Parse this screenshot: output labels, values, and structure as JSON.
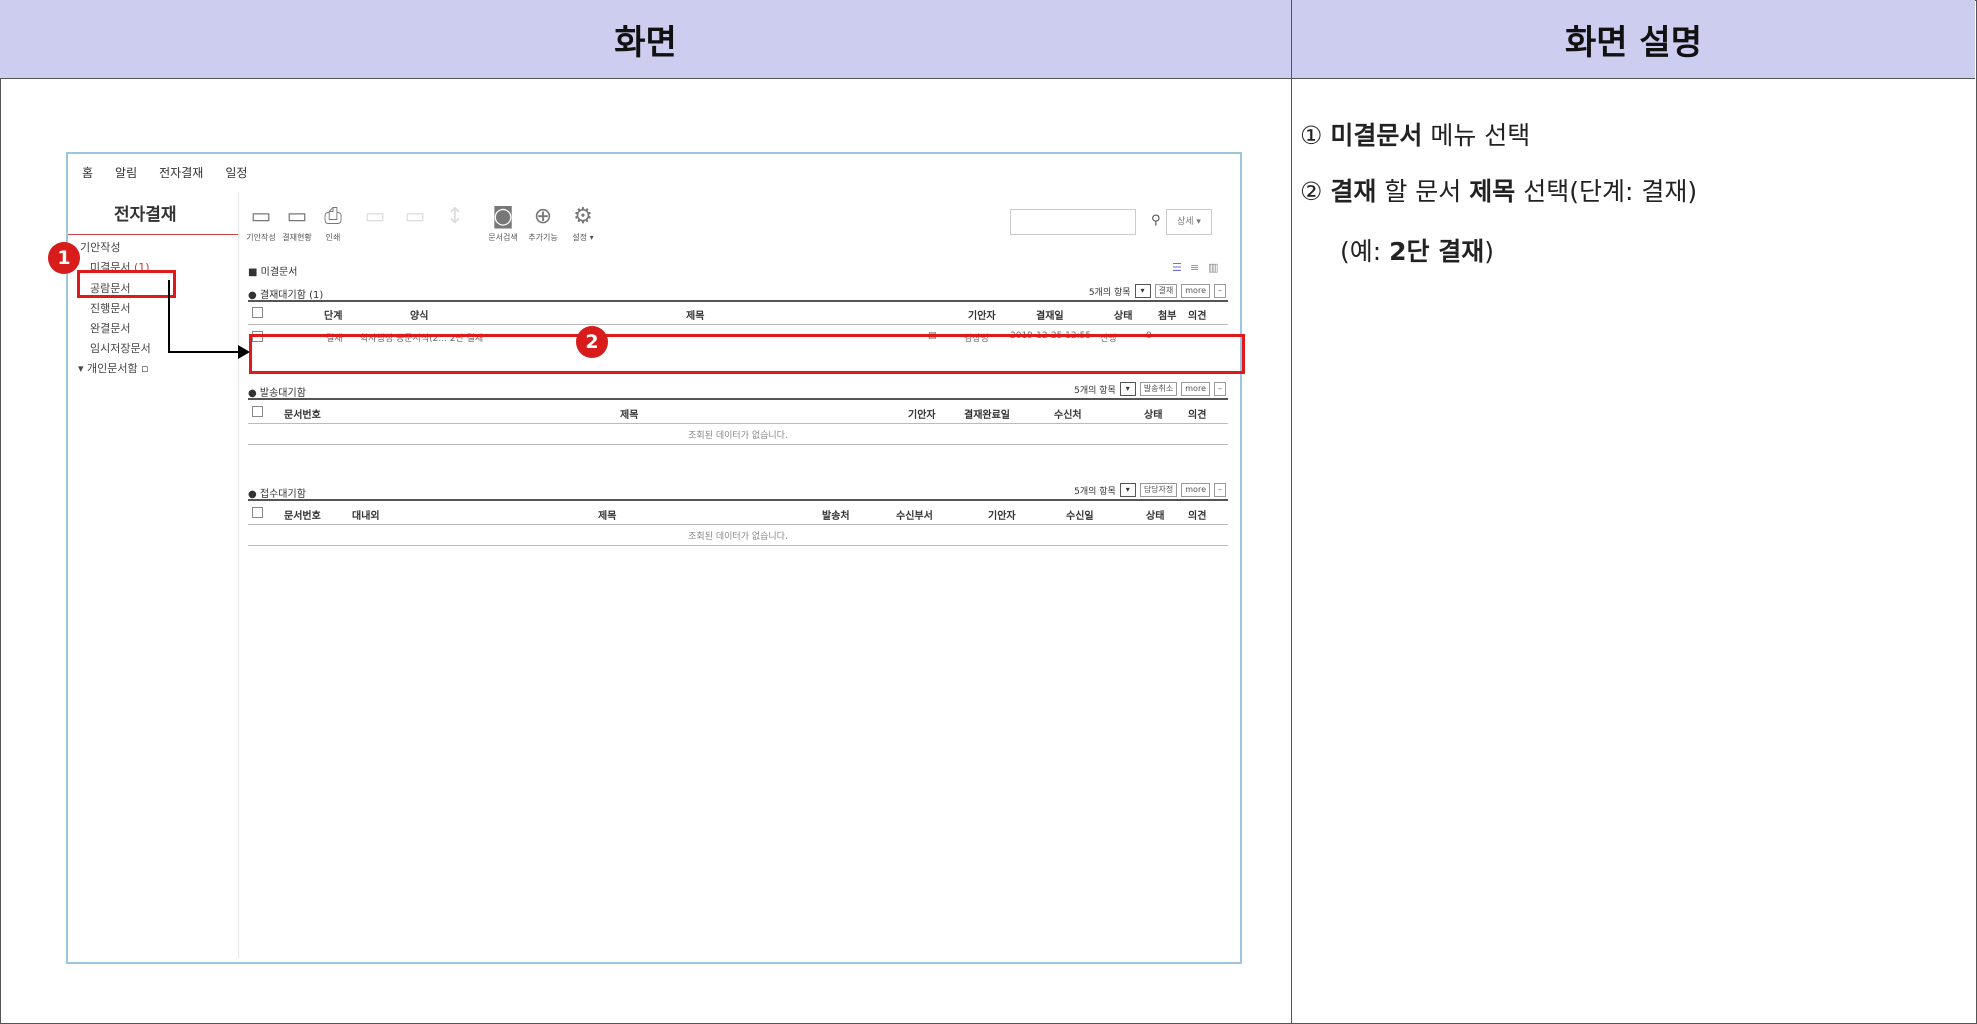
{
  "header": {
    "left": "화면",
    "right": "화면 설명"
  },
  "app": {
    "nav": [
      "홈",
      "알림",
      "전자결재",
      "일정"
    ],
    "sidebar": {
      "title": "전자결재",
      "items": [
        {
          "label": "기안작성",
          "count": ""
        },
        {
          "label": "미결문서",
          "count": "(1)"
        },
        {
          "label": "공람문서",
          "count": ""
        },
        {
          "label": "진행문서",
          "count": ""
        },
        {
          "label": "완결문서",
          "count": ""
        },
        {
          "label": "임시저장문서",
          "count": ""
        },
        {
          "label": "▾ 개인문서함",
          "count": ""
        }
      ]
    },
    "toolbar": [
      "기안작성",
      "결재현황",
      "인쇄",
      "문서검색",
      "추가기능",
      "설정 ▾"
    ],
    "search": {
      "select": "상세 ▾"
    },
    "page_title": "■ 미결문서",
    "sections": {
      "approval": {
        "title": "● 결재대기함 (1)",
        "count_label": "5개의 항목",
        "btns": [
          "결재",
          "more",
          "–"
        ],
        "columns": [
          "단계",
          "양식",
          "제목",
          "기안자",
          "결재일",
          "상태",
          "첨부",
          "의견"
        ],
        "row": {
          "stage": "결재",
          "form": "학사행정 공문서식(2... 2단 결재",
          "drafter": "김상명",
          "date": "2019-12-25 12:55",
          "status": "진행",
          "attach": "0"
        }
      },
      "send": {
        "title": "● 발송대기함",
        "count_label": "5개의 항목",
        "btns": [
          "발송취소",
          "more",
          "–"
        ],
        "columns": [
          "문서번호",
          "제목",
          "기안자",
          "결재완료일",
          "수신처",
          "상태",
          "의견"
        ],
        "empty": "조회된 데이터가 없습니다."
      },
      "receive": {
        "title": "● 접수대기함",
        "count_label": "5개의 항목",
        "btns": [
          "담당자정",
          "more",
          "–"
        ],
        "columns": [
          "문서번호",
          "대내외",
          "제목",
          "발송처",
          "수신부서",
          "기안자",
          "수신일",
          "상태",
          "의견"
        ],
        "empty": "조회된 데이터가 없습니다."
      }
    }
  },
  "badges": [
    "1",
    "2"
  ],
  "colors": {
    "header_bg": "#cdcdf0",
    "highlight": "#e01a1a",
    "badge": "#d81b1b"
  },
  "description": {
    "l1": {
      "num": "①",
      "b1": "미결문서",
      "t1": " 메뉴 선택"
    },
    "l2": {
      "num": "②",
      "b1": "결재",
      "t1": " 할 문서 ",
      "b2": "제목",
      "t2": " 선택(단계: 결재)"
    },
    "l3": {
      "t1": "(예: ",
      "b1": "2단 결재",
      "t2": ")"
    }
  }
}
